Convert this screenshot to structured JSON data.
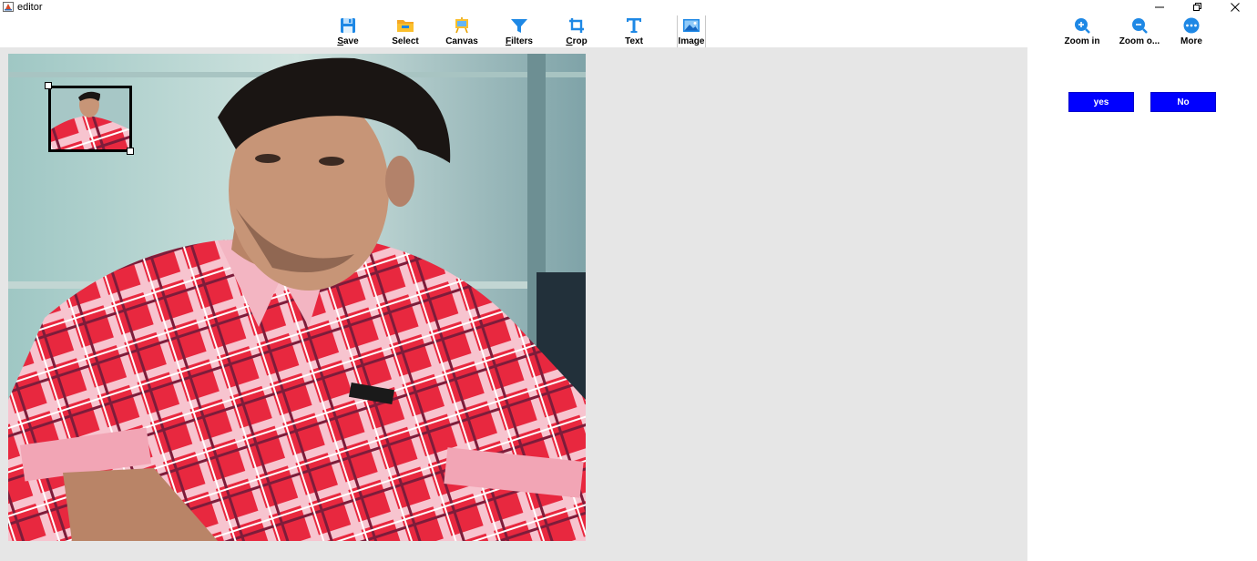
{
  "window": {
    "title": "editor",
    "controls": {
      "minimize_icon": "minimize-icon",
      "maximize_icon": "restore-icon",
      "close_icon": "close-icon"
    }
  },
  "toolbar": {
    "items": [
      {
        "mnemonic": "S",
        "rest": "ave",
        "icon": "floppy-disk-icon"
      },
      {
        "label": "Select",
        "icon": "folder-icon"
      },
      {
        "label": "Canvas",
        "icon": "easel-icon"
      },
      {
        "mnemonic": "F",
        "rest": "ilters",
        "icon": "funnel-icon"
      },
      {
        "mnemonic": "C",
        "rest": "rop",
        "icon": "crop-icon"
      },
      {
        "label": "Text",
        "icon": "text-t-icon"
      },
      {
        "label": "Image",
        "icon": "picture-icon"
      }
    ]
  },
  "view_tools": {
    "items": [
      {
        "label": "Zoom in",
        "icon": "zoom-in-icon"
      },
      {
        "label": "Zoom o...",
        "icon": "zoom-out-icon"
      },
      {
        "label": "More",
        "icon": "more-icon"
      }
    ]
  },
  "confirm": {
    "yes_label": "yes",
    "no_label": "No"
  },
  "colors": {
    "accent_blue": "#0000ff",
    "icon_blue": "#1e88e5",
    "canvas_bg": "#e6e6e6"
  }
}
